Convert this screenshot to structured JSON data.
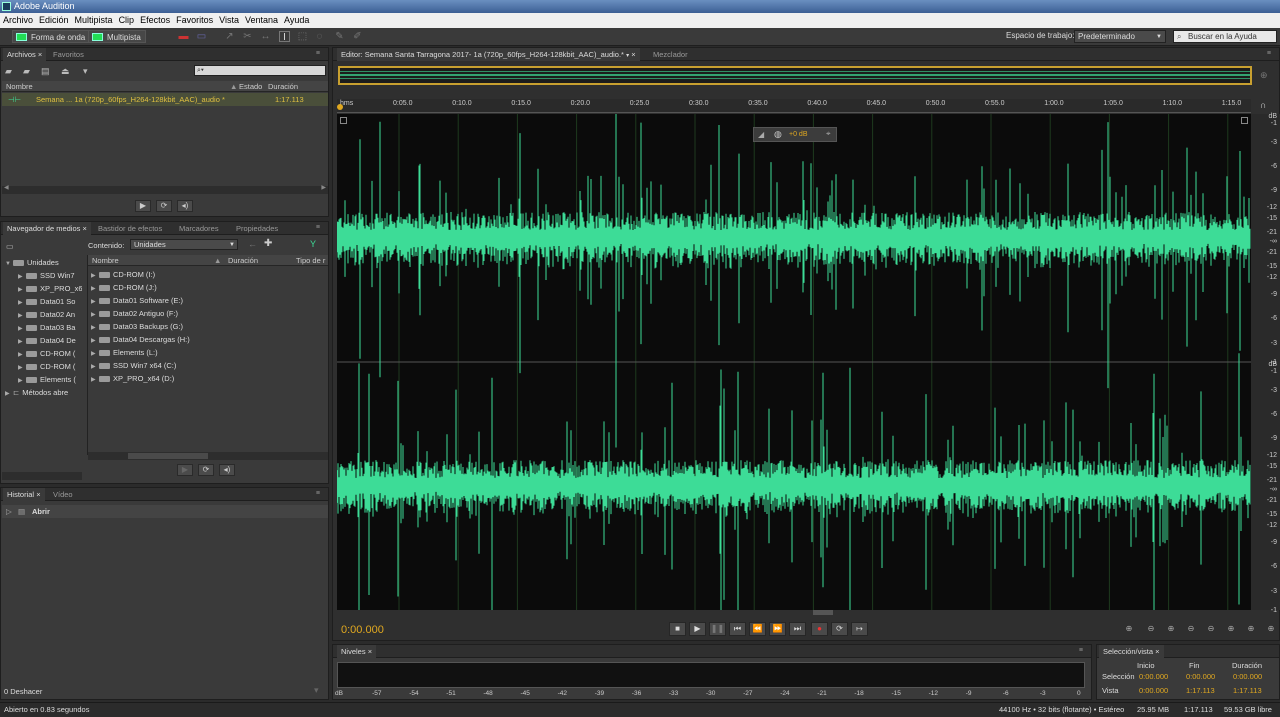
{
  "titlebar": {
    "title": "Adobe Audition"
  },
  "menu": [
    "Archivo",
    "Edición",
    "Multipista",
    "Clip",
    "Efectos",
    "Favoritos",
    "Vista",
    "Ventana",
    "Ayuda"
  ],
  "toolbar": {
    "waveform_label": "Forma de onda",
    "multitrack_label": "Multipista",
    "workspace_label": "Espacio de trabajo:",
    "workspace_value": "Predeterminado",
    "help_search_placeholder": "Buscar en la Ayuda"
  },
  "files_panel": {
    "tabs": [
      "Archivos",
      "Favoritos"
    ],
    "columns": {
      "name": "Nombre",
      "state": "Estado",
      "duration": "Duración"
    },
    "items": [
      {
        "name": "Semana ... 1a (720p_60fps_H264-128kbit_AAC)_audio *",
        "duration": "1:17.113"
      }
    ]
  },
  "media_panel": {
    "tabs": [
      "Navegador de medios",
      "Bastidor de efectos",
      "Marcadores",
      "Propiedades"
    ],
    "content_label": "Contenido:",
    "content_value": "Unidades",
    "tree": [
      "Unidades",
      "SSD Win7",
      "XP_PRO_x6",
      "Data01 So",
      "Data02 An",
      "Data03 Ba",
      "Data04 De",
      "CD-ROM (",
      "CD-ROM (",
      "Elements (",
      "Métodos abre"
    ],
    "columns": {
      "name": "Nombre",
      "duration": "Duración",
      "type": "Tipo de r"
    },
    "list": [
      "CD-ROM (I:)",
      "CD-ROM (J:)",
      "Data01 Software (E:)",
      "Data02 Antiguo (F:)",
      "Data03 Backups (G:)",
      "Data04 Descargas (H:)",
      "Elements (L:)",
      "SSD Win7 x64 (C:)",
      "XP_PRO_x64 (D:)"
    ]
  },
  "history_panel": {
    "tabs": [
      "Historial",
      "Vídeo"
    ],
    "items": [
      "Abrir"
    ],
    "undo_label": "0 Deshacer"
  },
  "editor": {
    "tab_label": "Editor: Semana Santa Tarragona 2017- 1a (720p_60fps_H264-128kbit_AAC)_audio.*",
    "mixer_tab": "Mezclador",
    "ruler_unit": "hms",
    "ruler_ticks": [
      "0:05.0",
      "0:10.0",
      "0:15.0",
      "0:20.0",
      "0:25.0",
      "0:30.0",
      "0:35.0",
      "0:40.0",
      "0:45.0",
      "0:50.0",
      "0:55.0",
      "1:00.0",
      "1:05.0",
      "1:10.0",
      "1:15.0"
    ],
    "hud_gain": "+0 dB",
    "db_scale": [
      "dB",
      "-1",
      "-3",
      "-6",
      "-9",
      "-12",
      "-15",
      "-21",
      "-∞",
      "-21",
      "-15",
      "-12",
      "-9",
      "-6",
      "-3",
      "-1"
    ],
    "current_time": "0:00.000",
    "waveform_color": "#3ddc97",
    "accent_color": "#e0a820"
  },
  "levels": {
    "tab": "Niveles",
    "scale": [
      "dB",
      "-57",
      "-54",
      "-51",
      "-48",
      "-45",
      "-42",
      "-39",
      "-36",
      "-33",
      "-30",
      "-27",
      "-24",
      "-21",
      "-18",
      "-15",
      "-12",
      "-9",
      "-6",
      "-3",
      "0"
    ]
  },
  "selection_panel": {
    "tab": "Selección/vista",
    "headers": {
      "start": "Inicio",
      "end": "Fin",
      "duration": "Duración"
    },
    "selection": {
      "label": "Selección",
      "start": "0:00.000",
      "end": "0:00.000",
      "duration": "0:00.000"
    },
    "view": {
      "label": "Vista",
      "start": "0:00.000",
      "end": "1:17.113",
      "duration": "1:17.113"
    }
  },
  "status": {
    "message": "Abierto en 0.83 segundos",
    "format": "44100 Hz • 32 bits (flotante) • Estéreo",
    "size": "25.95 MB",
    "duration": "1:17.113",
    "free": "59.53 GB libre"
  }
}
